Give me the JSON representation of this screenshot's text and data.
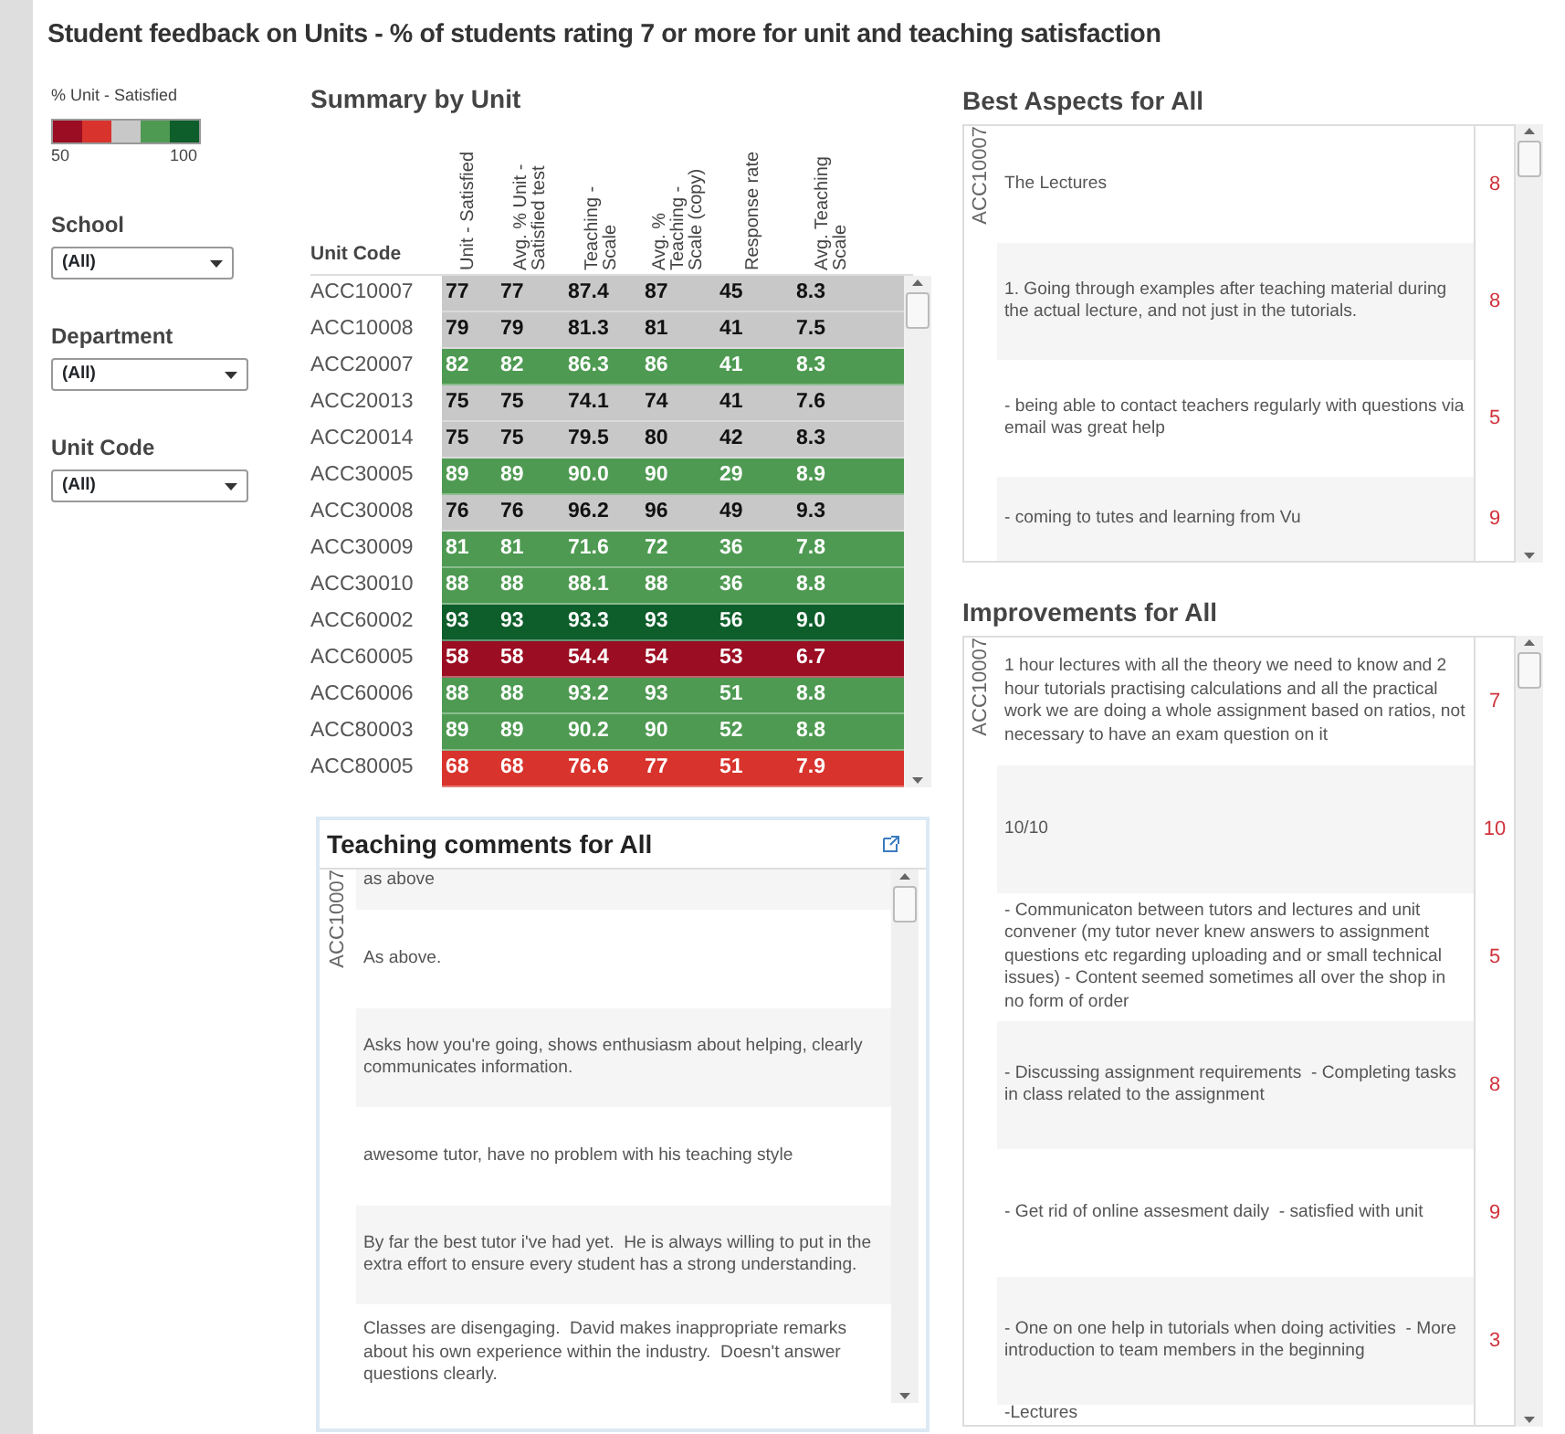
{
  "title": "Student feedback on Units - % of students rating 7 or more for unit and teaching satisfaction",
  "legend": {
    "title": "% Unit - Satisfied",
    "segments": [
      {
        "color": "#9b0d22"
      },
      {
        "color": "#d8332c"
      },
      {
        "color": "#c8c8c8"
      },
      {
        "color": "#4e9a52"
      },
      {
        "color": "#0d5e2a"
      }
    ],
    "min_label": "50",
    "max_label": "100"
  },
  "filters": [
    {
      "label": "School",
      "value": "(All)"
    },
    {
      "label": "Department",
      "value": "(All)"
    },
    {
      "label": "Unit Code",
      "value": "(All)"
    }
  ],
  "summary": {
    "title": "Summary by Unit",
    "code_header": "Unit Code",
    "columns": [
      "Unit - Satisfied",
      "Avg. % Unit - Satisfied test",
      "Teaching - Scale",
      "Avg. % Teaching - Scale (copy)",
      "Response rate",
      "Avg. Teaching Scale"
    ],
    "rows": [
      {
        "code": "ACC10007",
        "color": "#c8c8c8",
        "values": [
          "77",
          "77",
          "87.4",
          "87",
          "45",
          "8.3"
        ]
      },
      {
        "code": "ACC10008",
        "color": "#c8c8c8",
        "values": [
          "79",
          "79",
          "81.3",
          "81",
          "41",
          "7.5"
        ]
      },
      {
        "code": "ACC20007",
        "color": "#4e9a52",
        "values": [
          "82",
          "82",
          "86.3",
          "86",
          "41",
          "8.3"
        ]
      },
      {
        "code": "ACC20013",
        "color": "#c8c8c8",
        "values": [
          "75",
          "75",
          "74.1",
          "74",
          "41",
          "7.6"
        ]
      },
      {
        "code": "ACC20014",
        "color": "#c8c8c8",
        "values": [
          "75",
          "75",
          "79.5",
          "80",
          "42",
          "8.3"
        ]
      },
      {
        "code": "ACC30005",
        "color": "#4e9a52",
        "values": [
          "89",
          "89",
          "90.0",
          "90",
          "29",
          "8.9"
        ]
      },
      {
        "code": "ACC30008",
        "color": "#c8c8c8",
        "values": [
          "76",
          "76",
          "96.2",
          "96",
          "49",
          "9.3"
        ]
      },
      {
        "code": "ACC30009",
        "color": "#4e9a52",
        "values": [
          "81",
          "81",
          "71.6",
          "72",
          "36",
          "7.8"
        ]
      },
      {
        "code": "ACC30010",
        "color": "#4e9a52",
        "values": [
          "88",
          "88",
          "88.1",
          "88",
          "36",
          "8.8"
        ]
      },
      {
        "code": "ACC60002",
        "color": "#0d5e2a",
        "values": [
          "93",
          "93",
          "93.3",
          "93",
          "56",
          "9.0"
        ]
      },
      {
        "code": "ACC60005",
        "color": "#9b0d22",
        "values": [
          "58",
          "58",
          "54.4",
          "54",
          "53",
          "6.7"
        ]
      },
      {
        "code": "ACC60006",
        "color": "#4e9a52",
        "values": [
          "88",
          "88",
          "93.2",
          "93",
          "51",
          "8.8"
        ]
      },
      {
        "code": "ACC80003",
        "color": "#4e9a52",
        "values": [
          "89",
          "89",
          "90.2",
          "90",
          "52",
          "8.8"
        ]
      },
      {
        "code": "ACC80005",
        "color": "#d8332c",
        "values": [
          "68",
          "68",
          "76.6",
          "77",
          "51",
          "7.9"
        ]
      }
    ]
  },
  "teaching_comments": {
    "title": "Teaching comments for All",
    "unit": "ACC10007",
    "comments": [
      "as above",
      "As above.",
      "Asks how you're going, shows enthusiasm about helping, clearly communicates information.",
      "awesome tutor, have no problem with his teaching style",
      "By far the best tutor i've had yet.  He is always willing to put in the extra effort to ensure every student has a strong understanding.",
      "Classes are disengaging.  David makes inappropriate remarks about his own experience within the industry.  Doesn't answer questions clearly."
    ]
  },
  "best_aspects": {
    "title": "Best Aspects for All",
    "unit": "ACC10007",
    "items": [
      {
        "text": "The Lectures",
        "score": "8"
      },
      {
        "text": "1. Going through examples after teaching material during the actual lecture, and not just in the tutorials.",
        "score": "8"
      },
      {
        "text": "- being able to contact teachers regularly with questions via email was great help",
        "score": "5"
      },
      {
        "text": "- coming to tutes and learning from Vu",
        "score": "9"
      }
    ]
  },
  "improvements": {
    "title": "Improvements for All",
    "unit": "ACC10007",
    "items": [
      {
        "text": "1 hour lectures with all the theory we need to know and 2 hour tutorials practising calculations and all the practical work we are doing a whole assignment based on ratios, not necessary to have an exam question on it",
        "score": "7"
      },
      {
        "text": "10/10",
        "score": "10"
      },
      {
        "text": "- Communicaton between tutors and lectures and unit convener (my tutor never knew answers to assignment questions etc regarding uploading and or small technical issues) - Content seemed sometimes all over the shop in no form of order",
        "score": "5"
      },
      {
        "text": "- Discussing assignment requirements  - Completing tasks in class related to the assignment",
        "score": "8"
      },
      {
        "text": "- Get rid of online assesment daily  - satisfied with unit",
        "score": "9"
      },
      {
        "text": "- One on one help in tutorials when doing activities  - More introduction to team members in the beginning",
        "score": "3"
      },
      {
        "text": "-Lectures"
      }
    ]
  }
}
